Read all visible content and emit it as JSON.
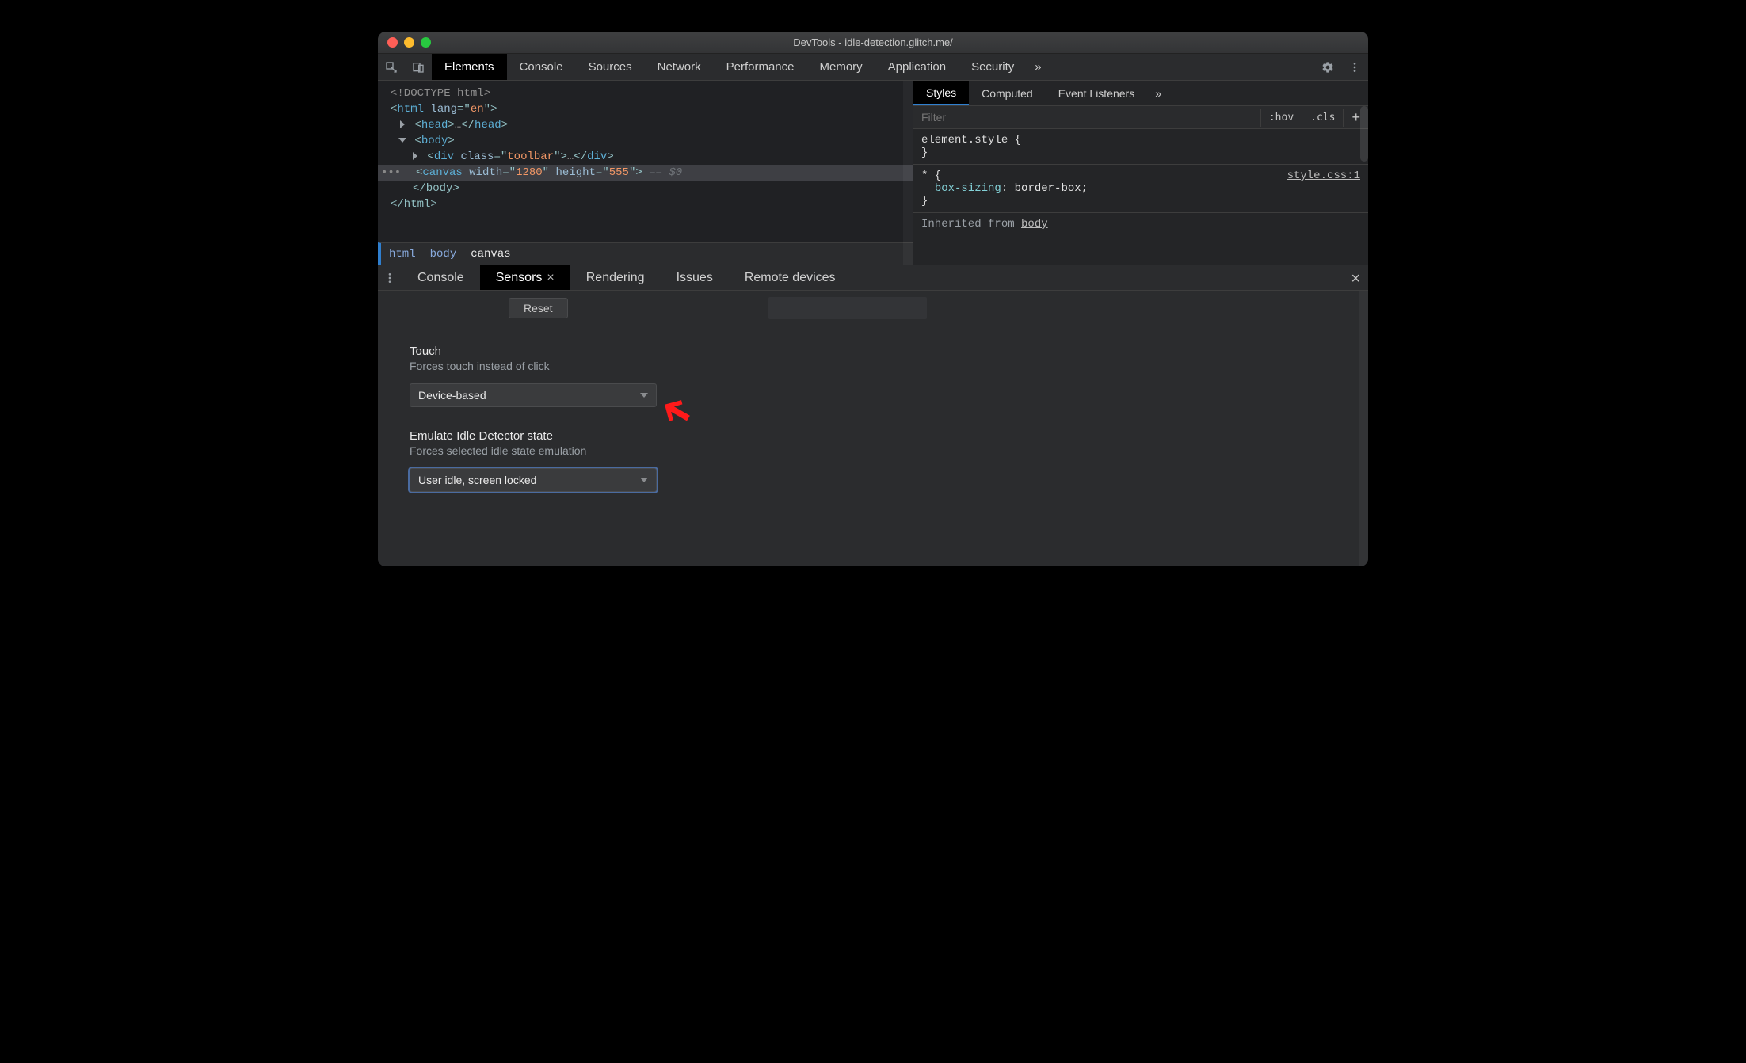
{
  "window": {
    "title": "DevTools - idle-detection.glitch.me/"
  },
  "toolbar": {
    "tabs": [
      "Elements",
      "Console",
      "Sources",
      "Network",
      "Performance",
      "Memory",
      "Application",
      "Security"
    ],
    "active_tab": "Elements",
    "more_glyph": "»"
  },
  "dom": {
    "doctype": "<!DOCTYPE html>",
    "html_open": {
      "tag": "html",
      "attr": "lang",
      "val": "en"
    },
    "head_line": {
      "tag": "head",
      "ellipsis": "…"
    },
    "body_line": {
      "tag": "body"
    },
    "div_line": {
      "tag": "div",
      "attr": "class",
      "val": "toolbar",
      "ellipsis": "…"
    },
    "canvas_line": {
      "tag": "canvas",
      "attrs": [
        [
          "width",
          "1280"
        ],
        [
          "height",
          "555"
        ]
      ],
      "hint": " == $0"
    },
    "close_body": "</body>",
    "close_html": "</html>"
  },
  "breadcrumb": {
    "items": [
      "html",
      "body",
      "canvas"
    ],
    "active": "canvas"
  },
  "styles": {
    "tabs": [
      "Styles",
      "Computed",
      "Event Listeners"
    ],
    "active": "Styles",
    "more_glyph": "»",
    "filter_placeholder": "Filter",
    "chips": {
      "hov": ":hov",
      "cls": ".cls",
      "plus": "+"
    },
    "element_style": {
      "open": "element.style {",
      "close": "}"
    },
    "star_rule": {
      "sel_open": "* {",
      "prop": "box-sizing",
      "val": "border-box",
      "close": "}",
      "link": "style.css:1"
    },
    "inherited": {
      "label": "Inherited from",
      "from": "body"
    }
  },
  "drawer": {
    "tabs": [
      "Console",
      "Sensors",
      "Rendering",
      "Issues",
      "Remote devices"
    ],
    "active": "Sensors",
    "reset_label": "Reset",
    "close_glyph": "×",
    "tab_close_glyph": "×",
    "touch": {
      "title": "Touch",
      "subtitle": "Forces touch instead of click",
      "value": "Device-based"
    },
    "idle": {
      "title": "Emulate Idle Detector state",
      "subtitle": "Forces selected idle state emulation",
      "value": "User idle, screen locked"
    }
  },
  "colors": {
    "accent": "#2f7fcf",
    "annotation": "#ff1a1a"
  }
}
